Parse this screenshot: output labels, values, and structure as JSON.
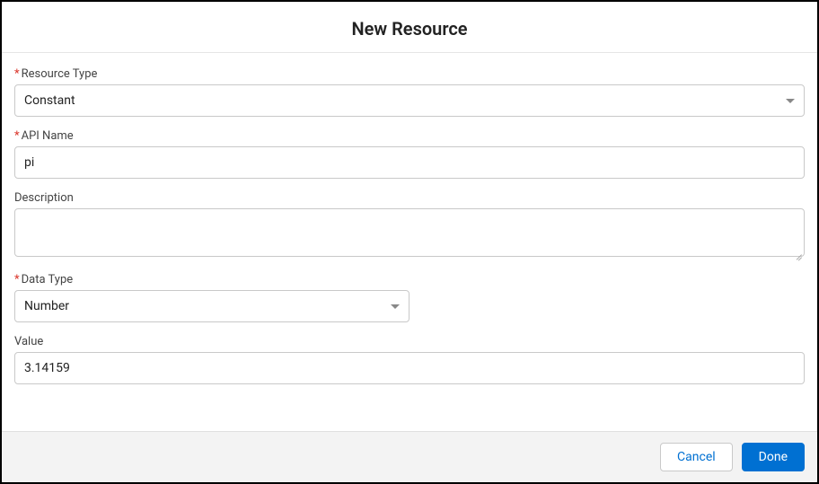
{
  "header": {
    "title": "New Resource"
  },
  "fields": {
    "resourceType": {
      "label": "Resource Type",
      "value": "Constant"
    },
    "apiName": {
      "label": "API Name",
      "value": "pi"
    },
    "description": {
      "label": "Description",
      "value": ""
    },
    "dataType": {
      "label": "Data Type",
      "value": "Number"
    },
    "valueField": {
      "label": "Value",
      "value": "3.14159"
    }
  },
  "footer": {
    "cancel": "Cancel",
    "done": "Done"
  }
}
